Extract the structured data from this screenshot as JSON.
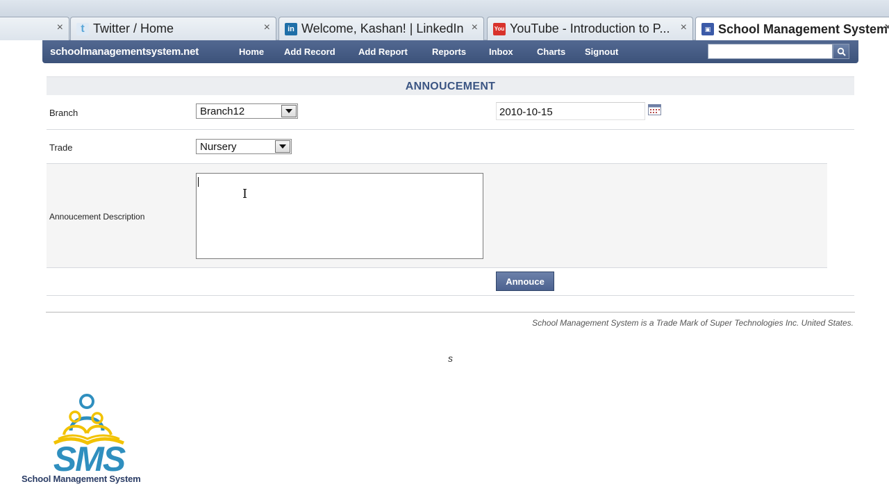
{
  "browser": {
    "tabs": [
      {
        "label": "",
        "icon": "blank-tab-icon",
        "active": false
      },
      {
        "label": "Twitter / Home",
        "icon": "twitter-icon",
        "active": false
      },
      {
        "label": "Welcome, Kashan! | LinkedIn",
        "icon": "linkedin-icon",
        "active": false
      },
      {
        "label": "YouTube - Introduction to P...",
        "icon": "youtube-icon",
        "active": false
      },
      {
        "label": "School Management System",
        "icon": "sms-favicon-icon",
        "active": true
      }
    ],
    "close_glyph": "×"
  },
  "nav": {
    "brand": "schoolmanagementsystem.net",
    "links": [
      "Home",
      "Add Record",
      "Add Report",
      "Reports",
      "Inbox",
      "Charts",
      "Signout"
    ],
    "search_value": "",
    "color": "#41577f"
  },
  "form": {
    "title": "ANNOUCEMENT",
    "branch_label": "Branch",
    "branch_value": "Branch12",
    "date_value": "2010-10-15",
    "trade_label": "Trade",
    "trade_value": "Nursery",
    "description_label": "Annoucement Description",
    "description_value": "",
    "submit_label": "Annouce"
  },
  "footer": {
    "trademark": "School Management System is a Trade Mark of Super Technologies Inc. United States.",
    "stray_char": "s"
  },
  "logo": {
    "wordmark": "SMS",
    "subtitle": "School Management System",
    "colors": {
      "primary": "#2f8fbf",
      "accent": "#f2c200",
      "text": "#2b3d66"
    }
  }
}
